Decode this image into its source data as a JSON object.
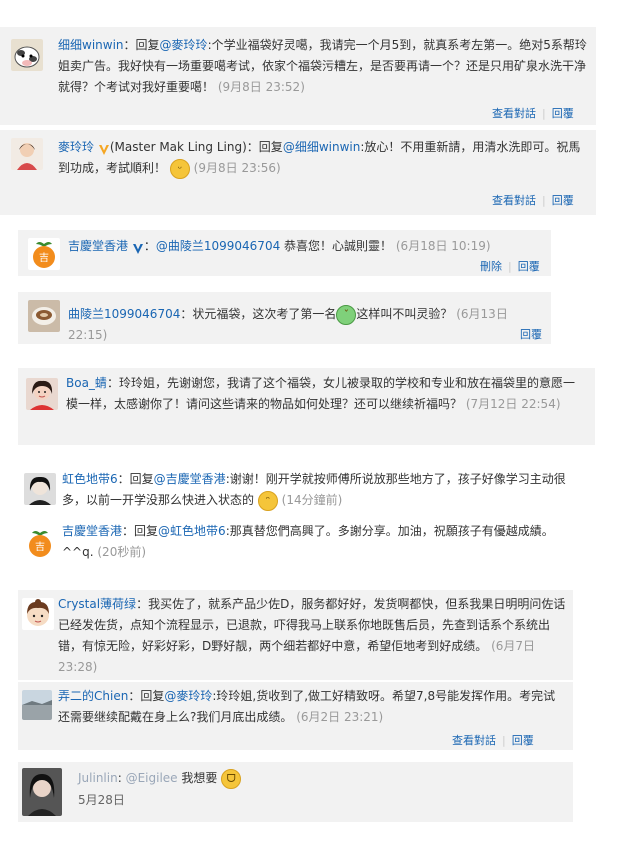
{
  "c1": {
    "user": "细细winwin",
    "colon": "：",
    "reply_prefix": "回复",
    "mention": "@麥玲玲",
    "body": ":个学业福袋好灵噶，我请完一个月5到，就真系考左第一。绝对5系帮玲姐卖广告。我好快有一场重要噶考试，依家个福袋污糟左，是否要再请一个？还是只用矿泉水洗干净就得？个考试对我好重要噶！",
    "time": "(9月8日 23:52)",
    "action_view": "查看對話",
    "action_reply": "回覆"
  },
  "c2": {
    "user": "麥玲玲",
    "english": "(Master Mak Ling Ling)",
    "colon": "：",
    "reply_prefix": "回复",
    "mention": "@细细winwin",
    "body": ":放心！不用重新請，用清水洗即可。祝馬到功成，考試順利！",
    "time": "(9月8日 23:56)",
    "action_view": "查看對話",
    "action_reply": "回覆"
  },
  "c3": {
    "user": "吉慶堂香港",
    "colon": "：",
    "mention": "@曲陵兰1099046704",
    "body": " 恭喜您！心誠則靈！",
    "time": "(6月18日 10:19)",
    "action_delete": "刪除",
    "action_reply": "回覆"
  },
  "c4": {
    "user": "曲陵兰1099046704",
    "colon": "：",
    "body_a": "状元福袋，这次考了第一名",
    "body_b": "这样叫不叫灵验？",
    "time": "(6月13日 22:15)",
    "action_reply": "回覆"
  },
  "c5": {
    "user": "Boa_蜻",
    "colon": "：",
    "body": "玲玲姐，先谢谢您，我请了这个福袋，女儿被录取的学校和专业和放在福袋里的意愿一模一样，太感谢你了！请问这些请来的物品如何处理？还可以继续祈福吗？",
    "time": "(7月12日 22:54)"
  },
  "c6": {
    "user": "虹色地带6",
    "colon": "：",
    "reply_prefix": "回复",
    "mention": "@吉慶堂香港",
    "body": ":谢谢！刚开学就按师傅所说放那些地方了，孩子好像学习主动很多，以前一开学没那么快进入状态的",
    "time": "(14分鐘前)"
  },
  "c7": {
    "user": "吉慶堂香港",
    "colon": "：",
    "reply_prefix": "回复",
    "mention": "@虹色地带6",
    "body": ":那真替您們高興了。多謝分享。加油，祝願孩子有優越成績。^^q.",
    "time": "(20秒前)"
  },
  "c8": {
    "user": "Crystal薄荷绿",
    "colon": "：",
    "body": "我买佐了，就系产品少佐D，服务都好好，发货啊都快，但系我果日明明问佐话已经发佐货，点知个流程显示，已退款，吓得我马上联系你地既售后员，先查到话系个系统出错，有惊无险，好彩好彩，D野好靓，两个细若都好中意，希望佢地考到好成绩。",
    "time": "(6月7日 23:28)"
  },
  "c9": {
    "user": "弄二的Chien",
    "colon": "：",
    "reply_prefix": "回复",
    "mention": "@麥玲玲",
    "body": ":玲玲姐,货收到了,做工好精致呀。希望7,8号能发挥作用。考完试还需要继续配戴在身上么?我们月底出成绩。",
    "time": "(6月2日 23:21)",
    "action_view": "查看對話",
    "action_reply": "回覆"
  },
  "c10": {
    "user": "Julinlin",
    "colon": ":",
    "mention": "@Eigilee",
    "body": " 我想要",
    "date": "5月28日"
  },
  "colors": {
    "link": "#1a66b3",
    "meta": "#999999",
    "panel": "#f2f2f2",
    "verified": "#f5a623"
  }
}
